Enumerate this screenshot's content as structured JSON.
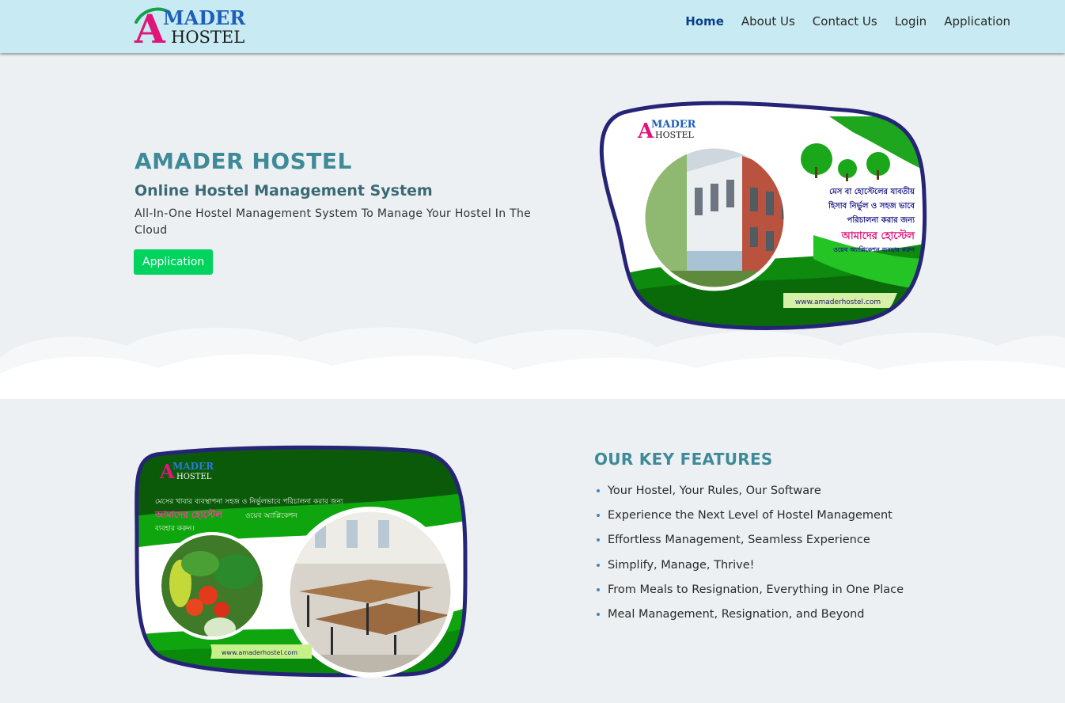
{
  "logo": {
    "line1": "MADER",
    "line2": "HOSTEL",
    "letter": "A"
  },
  "nav": {
    "items": [
      {
        "label": "Home",
        "active": true
      },
      {
        "label": "About Us",
        "active": false
      },
      {
        "label": "Contact Us",
        "active": false
      },
      {
        "label": "Login",
        "active": false
      },
      {
        "label": "Application",
        "active": false
      }
    ]
  },
  "hero": {
    "title": "AMADER HOSTEL",
    "subtitle": "Online Hostel Management System",
    "description": "All-In-One Hostel Management System To Manage Your Hostel In The Cloud",
    "button_label": "Application",
    "banner": {
      "logo_line1": "MADER",
      "logo_line2": "HOSTEL",
      "bn_line1": "মেস বা হোস্টেলের যাবতীয়",
      "bn_line2": "হিসাব নির্ভুল ও সহজ ভাবে",
      "bn_line3": "পরিচালনা করার জন্য",
      "bn_highlight": "আমাদের হোস্টেল",
      "bn_line4": "ওয়েব অ্যাপ্লিকেশন ব্যবহার করুন",
      "url": "www.amaderhostel.com"
    }
  },
  "features": {
    "title": "OUR KEY FEATURES",
    "items": [
      "Your Hostel, Your Rules, Our Software",
      "Experience the Next Level of Hostel Management",
      "Effortless Management, Seamless Experience",
      "Simplify, Manage, Thrive!",
      "From Meals to Resignation, Everything in One Place",
      "Meal Management, Resignation, and Beyond"
    ],
    "banner": {
      "logo_line1": "MADER",
      "logo_line2": "HOSTEL",
      "bn_line1": "মেসের খাবার ব্যবস্থাপনা সহজ ও নির্ভুলভাবে পরিচালনা করার জন্য",
      "bn_highlight": "আমাদের হোস্টেল",
      "bn_line2": "ওয়েব অ্যাপ্লিকেশন",
      "bn_line3": "ব্যবহার করুন।",
      "url": "www.amaderhostel.com"
    }
  },
  "colors": {
    "navbar": "#c8ebf3",
    "accent_teal": "#3f8a98",
    "button_green": "#00d35e",
    "active_nav": "#0a3e8c"
  }
}
